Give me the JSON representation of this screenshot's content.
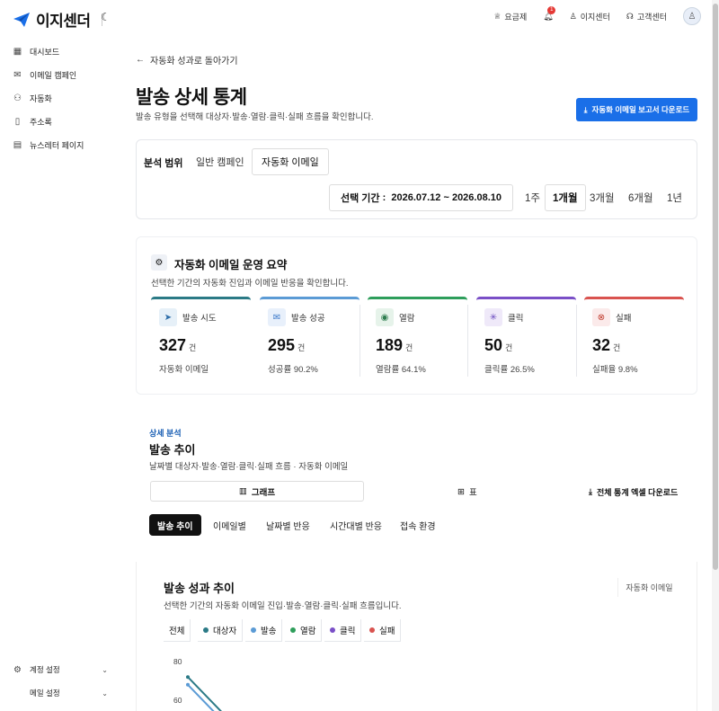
{
  "header": {
    "logo_text": "이지센더",
    "nav": {
      "pricing": "요금제",
      "notification_count": "1",
      "ezcenter": "이지센터",
      "support": "고객센터"
    }
  },
  "sidebar": {
    "items": [
      {
        "label": "대시보드",
        "icon": "dashboard-icon"
      },
      {
        "label": "이메일 캠페인",
        "icon": "mail-icon"
      },
      {
        "label": "자동화",
        "icon": "automation-icon"
      },
      {
        "label": "주소록",
        "icon": "book-icon"
      },
      {
        "label": "뉴스레터 페이지",
        "icon": "newsletter-icon"
      }
    ],
    "bottom": [
      {
        "label": "계정 설정",
        "icon": "gear-icon"
      },
      {
        "label": "메일 설정",
        "icon": "mail-settings-icon"
      }
    ]
  },
  "main": {
    "back_link": "자동화 성과로 돌아가기",
    "title": "발송 상세 통계",
    "subtitle": "발송 유형을 선택해 대상자·발송·열람·클릭·실패 흐름을 확인합니다.",
    "download_report": "자동화 이메일 보고서 다운로드"
  },
  "scope": {
    "label": "분석 범위",
    "tabs": [
      "일반 캠페인",
      "자동화 이메일"
    ],
    "active_tab": "자동화 이메일",
    "period_label": "선택 기간",
    "period_value": "2026.07.12 ~ 2026.08.10",
    "ranges": [
      "1주",
      "1개월",
      "3개월",
      "6개월",
      "1년"
    ],
    "active_range": "1개월"
  },
  "summary": {
    "title": "자동화 이메일 운영 요약",
    "subtitle": "선택한 기간의 자동화 진입과 이메일 반응을 확인합니다.",
    "metrics": [
      {
        "label": "발송 시도",
        "value": "327",
        "unit": "건",
        "note": "자동화 이메일",
        "color": "#2b7a86",
        "icon": "send-icon"
      },
      {
        "label": "발송 성공",
        "value": "295",
        "unit": "건",
        "note": "성공률 90.2%",
        "color": "#5b9bd5",
        "icon": "mail-icon"
      },
      {
        "label": "열람",
        "value": "189",
        "unit": "건",
        "note": "열람률 64.1%",
        "color": "#2e9e5b",
        "icon": "eye-icon"
      },
      {
        "label": "클릭",
        "value": "50",
        "unit": "건",
        "note": "클릭률 26.5%",
        "color": "#7a4fc7",
        "icon": "click-icon"
      },
      {
        "label": "실패",
        "value": "32",
        "unit": "건",
        "note": "실패율 9.8%",
        "color": "#d9534f",
        "icon": "fail-icon"
      }
    ]
  },
  "detail": {
    "section_label": "상세 분석",
    "title": "발송 추이",
    "subtitle": "날짜별 대상자·발송·열람·클릭·실패 흐름 · 자동화 이메일",
    "view_graph": "그래프",
    "view_table": "표",
    "excel_download": "전체 통계 엑셀 다운로드",
    "chips": [
      "발송 추이",
      "이메일별",
      "날짜별 반응",
      "시간대별 반응",
      "접속 환경"
    ],
    "active_chip": "발송 추이"
  },
  "trend": {
    "title": "발송 성과 추이",
    "subtitle": "선택한 기간의 자동화 이메일 진입·발송·열람·클릭·실패 흐름입니다.",
    "tag": "자동화 이메일",
    "legend_all": "전체",
    "legend": [
      {
        "label": "대상자",
        "color": "#2b7a86"
      },
      {
        "label": "발송",
        "color": "#5b9bd5"
      },
      {
        "label": "열람",
        "color": "#2e9e5b"
      },
      {
        "label": "클릭",
        "color": "#7a4fc7"
      },
      {
        "label": "실패",
        "color": "#d9534f"
      }
    ],
    "y_ticks": [
      "80",
      "60"
    ]
  },
  "chart_data": {
    "type": "line",
    "title": "발송 성과 추이",
    "ylim": [
      40,
      80
    ],
    "y_ticks": [
      80,
      60
    ],
    "series": [
      {
        "name": "대상자",
        "values": [
          72
        ]
      },
      {
        "name": "발송",
        "values": [
          68
        ]
      }
    ]
  }
}
